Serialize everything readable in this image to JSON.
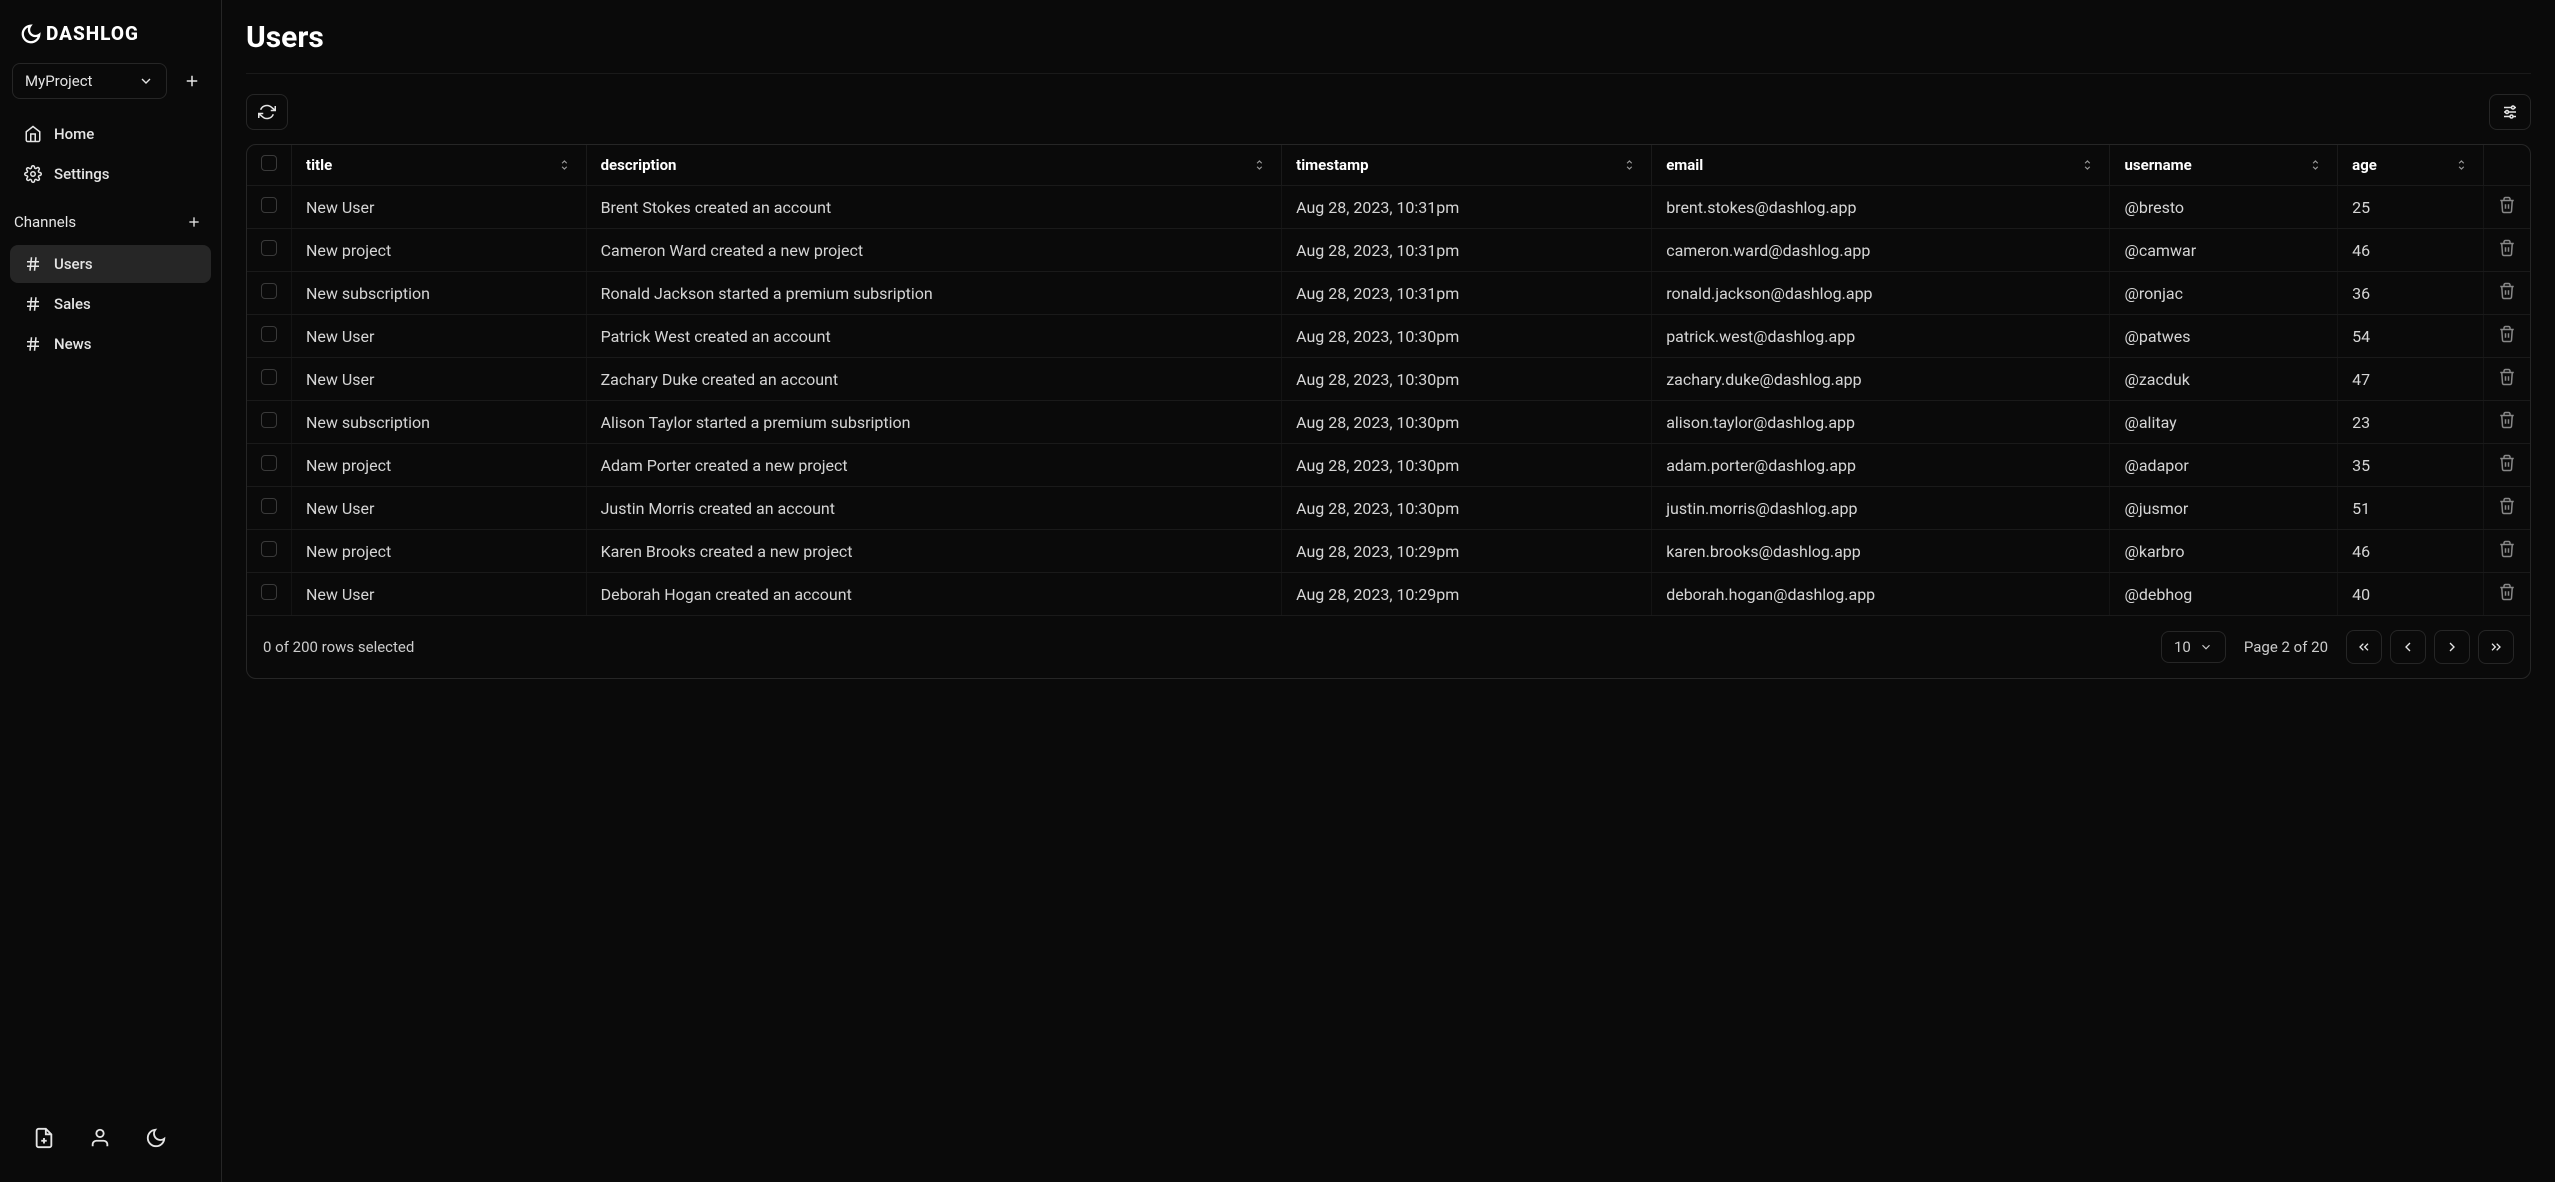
{
  "brand": "DASHLOG",
  "project": {
    "name": "MyProject"
  },
  "nav": {
    "home": "Home",
    "settings": "Settings"
  },
  "channels": {
    "header": "Channels",
    "items": [
      {
        "label": "Users",
        "active": true
      },
      {
        "label": "Sales",
        "active": false
      },
      {
        "label": "News",
        "active": false
      }
    ]
  },
  "page": {
    "title": "Users"
  },
  "table": {
    "columns": {
      "title": "title",
      "description": "description",
      "timestamp": "timestamp",
      "email": "email",
      "username": "username",
      "age": "age"
    },
    "rows": [
      {
        "title": "New User",
        "description": "Brent Stokes created an account",
        "timestamp": "Aug 28, 2023, 10:31pm",
        "email": "brent.stokes@dashlog.app",
        "username": "@bresto",
        "age": "25"
      },
      {
        "title": "New project",
        "description": "Cameron Ward created a new project",
        "timestamp": "Aug 28, 2023, 10:31pm",
        "email": "cameron.ward@dashlog.app",
        "username": "@camwar",
        "age": "46"
      },
      {
        "title": "New subscription",
        "description": "Ronald Jackson started a premium subsription",
        "timestamp": "Aug 28, 2023, 10:31pm",
        "email": "ronald.jackson@dashlog.app",
        "username": "@ronjac",
        "age": "36"
      },
      {
        "title": "New User",
        "description": "Patrick West created an account",
        "timestamp": "Aug 28, 2023, 10:30pm",
        "email": "patrick.west@dashlog.app",
        "username": "@patwes",
        "age": "54"
      },
      {
        "title": "New User",
        "description": "Zachary Duke created an account",
        "timestamp": "Aug 28, 2023, 10:30pm",
        "email": "zachary.duke@dashlog.app",
        "username": "@zacduk",
        "age": "47"
      },
      {
        "title": "New subscription",
        "description": "Alison Taylor started a premium subsription",
        "timestamp": "Aug 28, 2023, 10:30pm",
        "email": "alison.taylor@dashlog.app",
        "username": "@alitay",
        "age": "23"
      },
      {
        "title": "New project",
        "description": "Adam Porter created a new project",
        "timestamp": "Aug 28, 2023, 10:30pm",
        "email": "adam.porter@dashlog.app",
        "username": "@adapor",
        "age": "35"
      },
      {
        "title": "New User",
        "description": "Justin Morris created an account",
        "timestamp": "Aug 28, 2023, 10:30pm",
        "email": "justin.morris@dashlog.app",
        "username": "@jusmor",
        "age": "51"
      },
      {
        "title": "New project",
        "description": "Karen Brooks created a new project",
        "timestamp": "Aug 28, 2023, 10:29pm",
        "email": "karen.brooks@dashlog.app",
        "username": "@karbro",
        "age": "46"
      },
      {
        "title": "New User",
        "description": "Deborah Hogan created an account",
        "timestamp": "Aug 28, 2023, 10:29pm",
        "email": "deborah.hogan@dashlog.app",
        "username": "@debhog",
        "age": "40"
      }
    ]
  },
  "footer": {
    "selection": "0 of 200 rows selected",
    "pageSize": "10",
    "pageInfo": "Page 2 of 20"
  }
}
